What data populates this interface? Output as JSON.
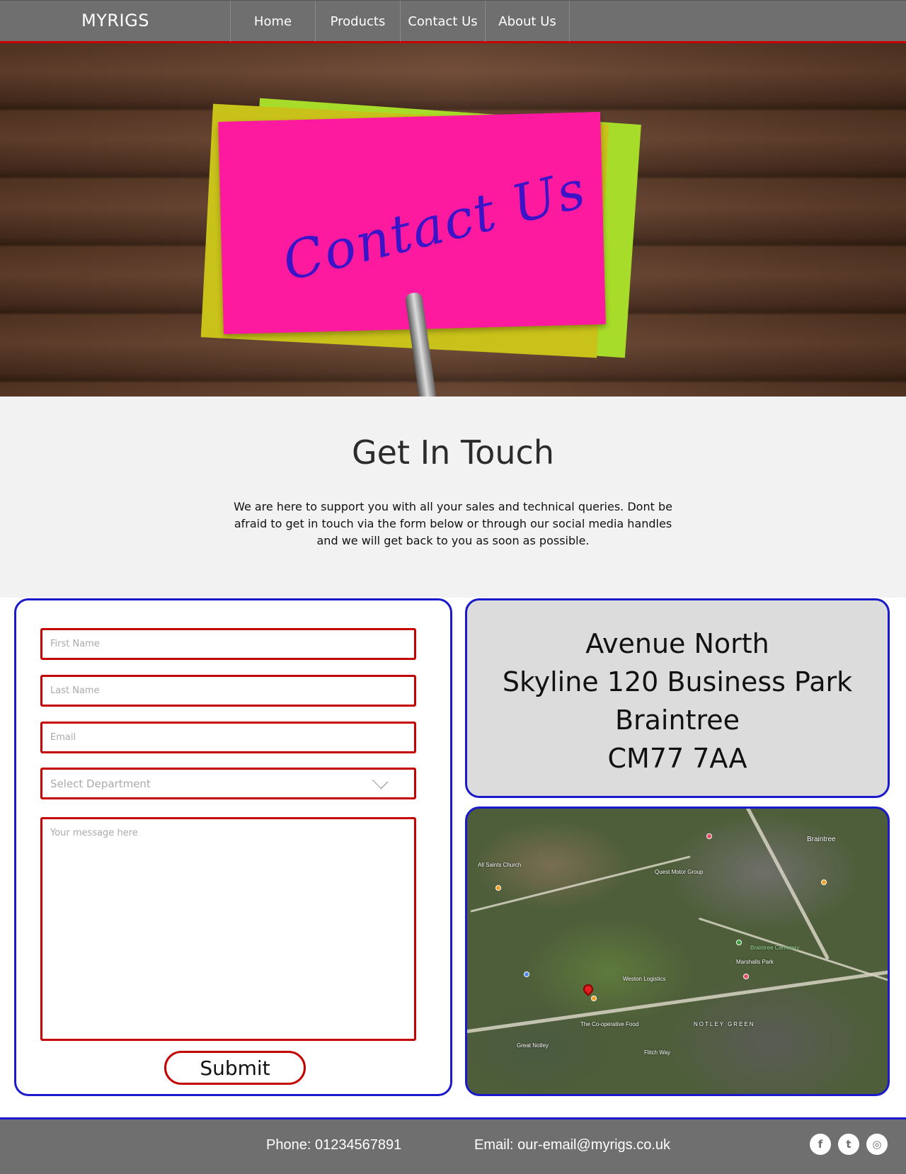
{
  "nav": {
    "brand": "MYRIGS",
    "items": [
      {
        "label": "Home"
      },
      {
        "label": "Products"
      },
      {
        "label": "Contact Us"
      },
      {
        "label": "About Us"
      }
    ]
  },
  "hero": {
    "note_text": "Contact Us"
  },
  "intro": {
    "title": "Get In Touch",
    "text": "We are here to support you with all your sales and technical queries. Dont be afraid to get in touch via the form below or through our social media handles and we will get back to you as soon as possible."
  },
  "form": {
    "first_name_placeholder": "First Name",
    "last_name_placeholder": "Last Name",
    "email_placeholder": "Email",
    "department_placeholder": "Select Department",
    "message_placeholder": "Your message here",
    "submit_label": "Submit"
  },
  "address": {
    "lines": [
      "Avenue North",
      "Skyline 120 Business Park",
      "Braintree",
      "CM77 7AA"
    ]
  },
  "map": {
    "labels": [
      "All Saints Church",
      "Braintree",
      "Quest Motor Group",
      "Great Notley",
      "NOTLEY GREEN",
      "Braintree Cemetery",
      "Marshalls Park",
      "The Co-operative Food",
      "Weston Logistics",
      "Flitch Way"
    ]
  },
  "footer": {
    "phone": "Phone: 01234567891",
    "email": "Email: our-email@myrigs.co.uk",
    "social": [
      {
        "icon": "facebook-icon",
        "glyph": "f"
      },
      {
        "icon": "twitter-icon",
        "glyph": "t"
      },
      {
        "icon": "dribbble-icon",
        "glyph": "◎"
      }
    ]
  },
  "colors": {
    "nav_bg": "#6f6f6f",
    "accent_red": "#c40000",
    "accent_blue": "#1a1acc",
    "note_pink": "#fd1a9f"
  }
}
